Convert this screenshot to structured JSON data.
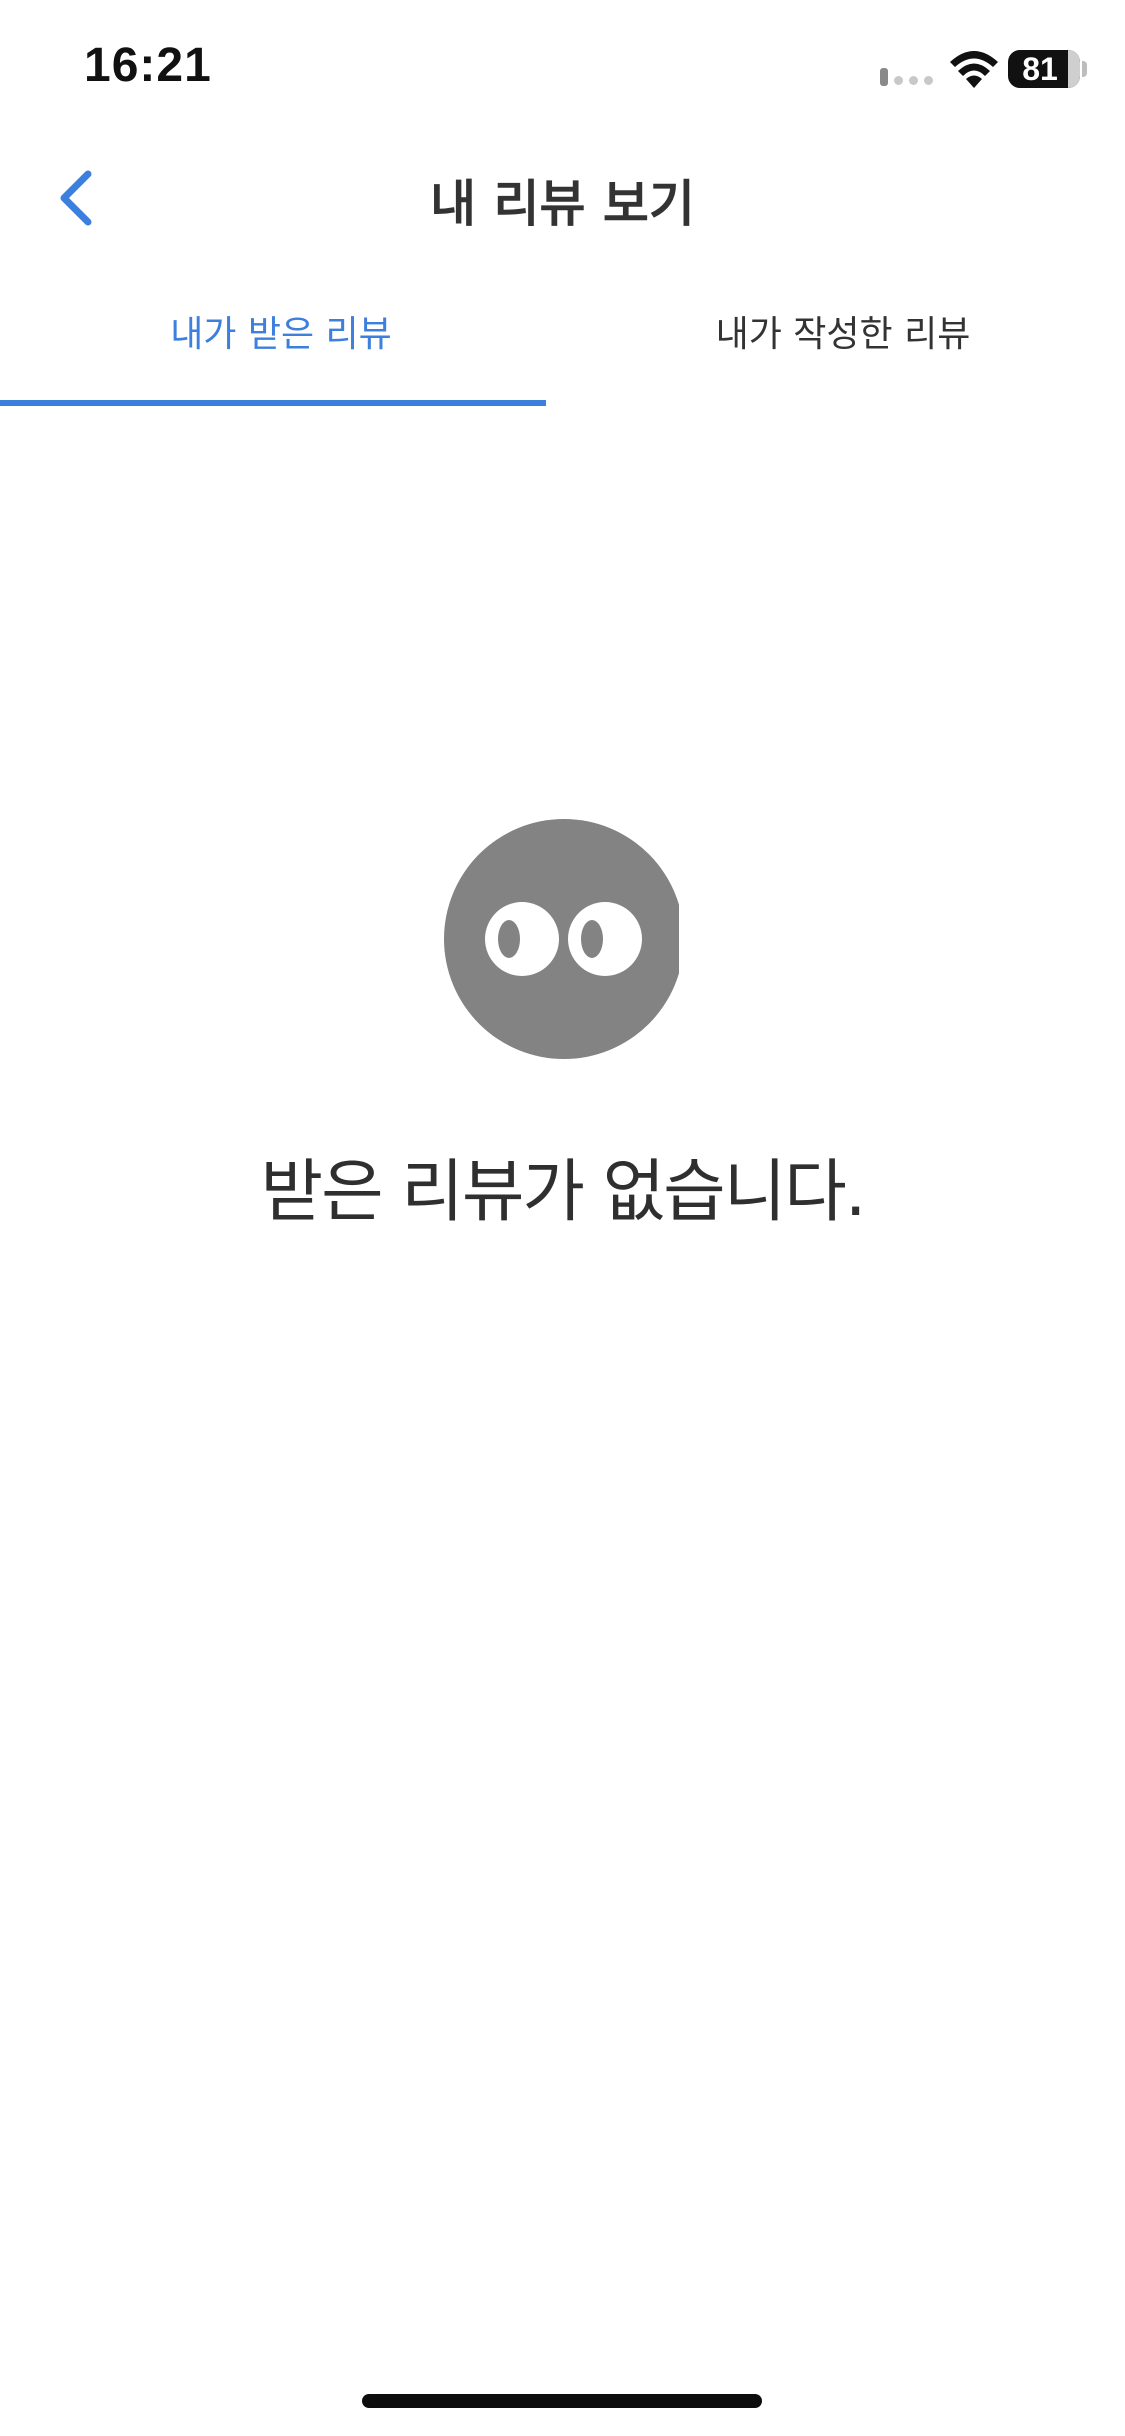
{
  "status_bar": {
    "time": "16:21",
    "battery_level": "81",
    "signal_icon": "cellular-signal-icon",
    "wifi_icon": "wifi-icon"
  },
  "header": {
    "title": "내 리뷰 보기",
    "back_icon": "chevron-left-icon"
  },
  "tabs": [
    {
      "label": "내가 받은 리뷰",
      "selected": true
    },
    {
      "label": "내가 작성한 리뷰",
      "selected": false
    }
  ],
  "empty_state": {
    "icon": "eyes-face-icon",
    "message": "받은 리뷰가 없습니다."
  },
  "colors": {
    "accent": "#3d7fdc",
    "text": "#333333",
    "icon_gray": "#838383",
    "background": "#ffffff"
  }
}
